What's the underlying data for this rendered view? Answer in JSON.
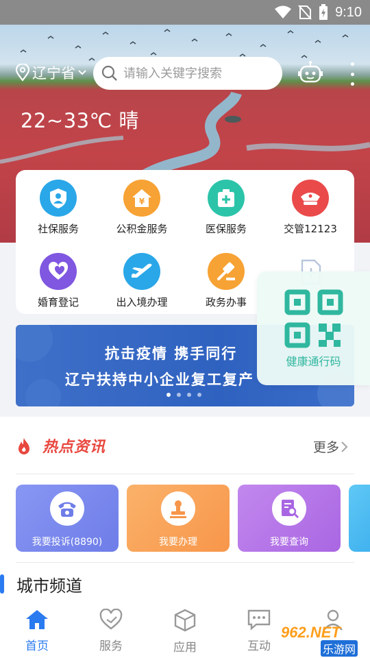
{
  "status_bar": {
    "time": "9:10",
    "icons": [
      "wifi-icon",
      "no-sim-icon",
      "battery-charging-icon"
    ]
  },
  "header": {
    "location": "辽宁省",
    "search_placeholder": "请输入关键字搜索",
    "weather": "22~33℃  晴"
  },
  "services": [
    {
      "label": "社保服务",
      "icon": "social-security-icon",
      "color": "#2aa7e8"
    },
    {
      "label": "公积金服务",
      "icon": "housing-fund-icon",
      "color": "#f7a234"
    },
    {
      "label": "医保服务",
      "icon": "medical-insurance-icon",
      "color": "#2cc4a9"
    },
    {
      "label": "交管12123",
      "icon": "traffic-police-icon",
      "color": "#ea4a4a"
    },
    {
      "label": "婚育登记",
      "icon": "marriage-icon",
      "color": "#7f57e0"
    },
    {
      "label": "出入境办理",
      "icon": "airplane-icon",
      "color": "#2aa7e8"
    },
    {
      "label": "政务办事",
      "icon": "gavel-icon",
      "color": "#f7a234"
    }
  ],
  "qr": {
    "label": "健康通行码",
    "color": "#2fb79f"
  },
  "banner": {
    "line1": "抗击疫情    携手同行",
    "line2": "辽宁扶持中小企业复工复产",
    "slides": 4,
    "active_slide": 1
  },
  "news": {
    "title": "热点资讯",
    "more": "更多",
    "actions": [
      {
        "label": "我要投诉(8890)",
        "icon": "phone-icon",
        "color": "#7a86f0"
      },
      {
        "label": "我要办理",
        "icon": "stamp-icon",
        "color": "#f8a45a"
      },
      {
        "label": "我要查询",
        "icon": "search-doc-icon",
        "color": "#b876ea"
      }
    ],
    "city_channel": "城市频道"
  },
  "tabbar": [
    {
      "label": "首页",
      "icon": "home-icon",
      "active": true
    },
    {
      "label": "服务",
      "icon": "heart-hands-icon",
      "active": false
    },
    {
      "label": "应用",
      "icon": "cube-icon",
      "active": false
    },
    {
      "label": "互动",
      "icon": "chat-icon",
      "active": false
    },
    {
      "label": "",
      "icon": "user-icon",
      "active": false
    }
  ],
  "watermark": {
    "brand": "962.NET",
    "site": "乐游网"
  },
  "colors": {
    "accent": "#2a7af0",
    "hot": "#e8483f"
  }
}
